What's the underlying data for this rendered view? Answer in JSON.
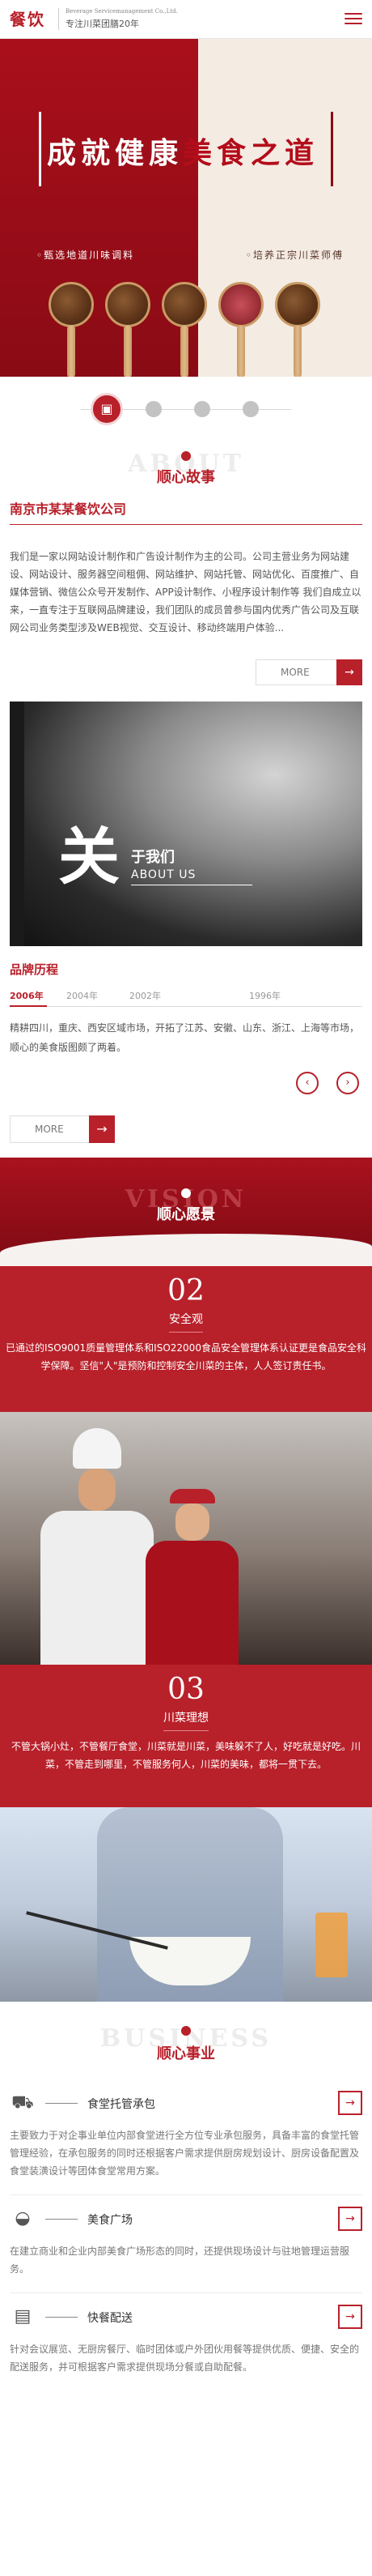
{
  "header": {
    "logo": "餐饮",
    "logo_en": "Beverage Servicemanagement Co.,Ltd.",
    "logo_cn": "专注川菜团膳20年",
    "menu_icon": "hamburger-menu-icon"
  },
  "banner": {
    "title_white": "成就健康",
    "title_red": "美食之道",
    "tag_left": "◦甄选地道川味调料",
    "tag_right": "◦培养正宗川菜师傅"
  },
  "about": {
    "ghost": "ABOUT",
    "title": "顺心故事",
    "company": "南京市某某餐饮公司",
    "intro": "我们是一家以网站设计制作和广告设计制作为主的公司。公司主营业务为网站建设、网站设计、服务器空间租佣、网站维护、网站托管、网站优化、百度推广、自媒体营销、微信公众号开发制作、APP设计制作、小程序设计制作等 我们自成立以来，一直专注于互联网品牌建设，我们团队的成员曾参与国内优秀广告公司及互联网公司业务类型涉及WEB视觉、交互设计、移动终端用户体验...",
    "more": "MORE",
    "image_big": "关",
    "image_small": "于我们",
    "image_en": "ABOUT US"
  },
  "history": {
    "title": "品牌历程",
    "years": [
      "2006年",
      "2004年",
      "2002年",
      "1996年"
    ],
    "active_year": "2006年",
    "text": "精耕四川，重庆、西安区域市场，开拓了江苏、安徽、山东、浙江、上海等市场，顺心的美食版图颇了两着。",
    "more": "MORE"
  },
  "vision": {
    "ghost": "VISION",
    "title": "顺心愿景",
    "card1": {
      "num": "02",
      "title": "安全观",
      "text": "已通过的ISO9001质量管理体系和ISO22000食品安全管理体系认证更是食品安全科学保障。坚信\"人\"是预防和控制安全川菜的主体，人人签订责任书。"
    },
    "card2": {
      "num": "03",
      "title": "川菜理想",
      "text": "不管大锅小灶，不管餐厅食堂，川菜就是川菜，美味躲不了人，好吃就是好吃。川菜，不管走到哪里，不管服务何人，川菜的美味，都将一贯下去。"
    }
  },
  "business": {
    "ghost": "BUSINESS",
    "title": "顺心事业",
    "items": [
      {
        "icon": "truck-icon",
        "name": "食堂托管承包",
        "desc": "主要致力于对企事业单位内部食堂进行全方位专业承包服务，具备丰富的食堂托管管理经验，在承包服务的同时还根据客户需求提供厨房规划设计、厨房设备配置及食堂装潢设计等团体食堂常用方案。"
      },
      {
        "icon": "bowl-icon",
        "name": "美食广场",
        "desc": "在建立商业和企业内部美食广场形态的同时，还提供现场设计与驻地管理运营服务。"
      },
      {
        "icon": "delivery-icon",
        "name": "快餐配送",
        "desc": "针对会议展览、无厨房餐厅、临时团体或户外团伙用餐等提供优质、便捷、安全的配送服务，并可根据客户需求提供现场分餐或自助配餐。"
      }
    ]
  }
}
